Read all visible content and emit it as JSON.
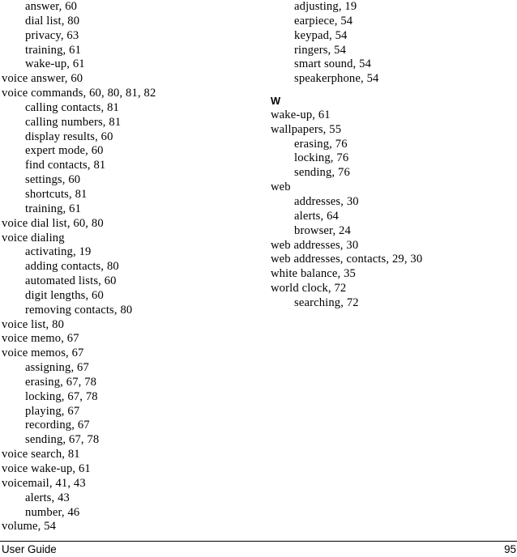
{
  "document": {
    "type": "index",
    "page_number": "95",
    "footer_title": "User Guide"
  },
  "columns": {
    "left": {
      "entries": [
        {
          "text": "answer, 60",
          "level": 1
        },
        {
          "text": "dial list, 80",
          "level": 1
        },
        {
          "text": "privacy, 63",
          "level": 1
        },
        {
          "text": "training, 61",
          "level": 1
        },
        {
          "text": "wake-up, 61",
          "level": 1
        },
        {
          "text": "voice answer, 60",
          "level": 0
        },
        {
          "text": "voice commands, 60, 80, 81, 82",
          "level": 0
        },
        {
          "text": "calling contacts, 81",
          "level": 1
        },
        {
          "text": "calling numbers, 81",
          "level": 1
        },
        {
          "text": "display results, 60",
          "level": 1
        },
        {
          "text": "expert mode, 60",
          "level": 1
        },
        {
          "text": "find contacts, 81",
          "level": 1
        },
        {
          "text": "settings, 60",
          "level": 1
        },
        {
          "text": "shortcuts, 81",
          "level": 1
        },
        {
          "text": "training, 61",
          "level": 1
        },
        {
          "text": "voice dial list, 60, 80",
          "level": 0
        },
        {
          "text": "voice dialing",
          "level": 0
        },
        {
          "text": "activating, 19",
          "level": 1
        },
        {
          "text": "adding contacts, 80",
          "level": 1
        },
        {
          "text": "automated lists, 60",
          "level": 1
        },
        {
          "text": "digit lengths, 60",
          "level": 1
        },
        {
          "text": "removing contacts, 80",
          "level": 1
        },
        {
          "text": "voice list, 80",
          "level": 0
        },
        {
          "text": "voice memo, 67",
          "level": 0
        },
        {
          "text": "voice memos, 67",
          "level": 0
        },
        {
          "text": "assigning, 67",
          "level": 1
        },
        {
          "text": "erasing, 67, 78",
          "level": 1
        },
        {
          "text": "locking, 67, 78",
          "level": 1
        },
        {
          "text": "playing, 67",
          "level": 1
        },
        {
          "text": "recording, 67",
          "level": 1
        },
        {
          "text": "sending, 67, 78",
          "level": 1
        },
        {
          "text": "voice search, 81",
          "level": 0
        },
        {
          "text": "voice wake-up, 61",
          "level": 0
        },
        {
          "text": "voicemail, 41, 43",
          "level": 0
        },
        {
          "text": "alerts, 43",
          "level": 1
        },
        {
          "text": "number, 46",
          "level": 1
        },
        {
          "text": "volume, 54",
          "level": 0
        }
      ]
    },
    "right": {
      "entries": [
        {
          "text": "adjusting, 19",
          "level": 1
        },
        {
          "text": "earpiece, 54",
          "level": 1
        },
        {
          "text": "keypad, 54",
          "level": 1
        },
        {
          "text": "ringers, 54",
          "level": 1
        },
        {
          "text": "smart sound, 54",
          "level": 1
        },
        {
          "text": "speakerphone, 54",
          "level": 1
        },
        {
          "text": "W",
          "level": "heading"
        },
        {
          "text": "wake-up, 61",
          "level": 0
        },
        {
          "text": "wallpapers, 55",
          "level": 0
        },
        {
          "text": "erasing, 76",
          "level": 1
        },
        {
          "text": "locking, 76",
          "level": 1
        },
        {
          "text": "sending, 76",
          "level": 1
        },
        {
          "text": "web",
          "level": 0
        },
        {
          "text": "addresses, 30",
          "level": 1
        },
        {
          "text": "alerts, 64",
          "level": 1
        },
        {
          "text": "browser, 24",
          "level": 1
        },
        {
          "text": "web addresses, 30",
          "level": 0
        },
        {
          "text": "web addresses, contacts, 29, 30",
          "level": 0
        },
        {
          "text": "white balance, 35",
          "level": 0
        },
        {
          "text": "world clock, 72",
          "level": 0
        },
        {
          "text": "searching, 72",
          "level": 1
        }
      ]
    }
  }
}
